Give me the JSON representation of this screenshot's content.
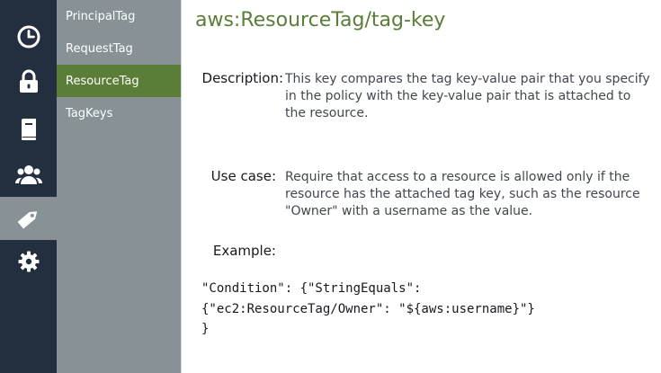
{
  "rail": {
    "items": [
      {
        "icon": "clock-icon",
        "active": false
      },
      {
        "icon": "lock-icon",
        "active": false
      },
      {
        "icon": "book-icon",
        "active": false
      },
      {
        "icon": "users-icon",
        "active": false
      },
      {
        "icon": "tag-icon",
        "active": true
      },
      {
        "icon": "gear-icon",
        "active": false
      }
    ],
    "colors": {
      "background": "#232f3e",
      "active": "#879196"
    }
  },
  "subnav": {
    "items": [
      {
        "label": "PrincipalTag",
        "active": false
      },
      {
        "label": "RequestTag",
        "active": false
      },
      {
        "label": "ResourceTag",
        "active": true
      },
      {
        "label": "TagKeys",
        "active": false
      }
    ],
    "colors": {
      "background": "#879196",
      "active": "#5a7e37"
    }
  },
  "main": {
    "title": "aws:ResourceTag/tag-key",
    "description_label": "Description:",
    "description": "This key compares the tag key-value pair that you specify in the policy with the key-value pair that is attached to the resource.",
    "use_case_label": "Use case:",
    "use_case": "Require that access to a resource is allowed only if the resource has the attached tag key, such as the resource \"Owner\" with a username as the value.",
    "example_label": "Example:",
    "example_code": "\"Condition\": {\"StringEquals\":\n{\"ec2:ResourceTag/Owner\": \"${aws:username}\"}\n}"
  },
  "accent_color": "#5a7e37"
}
